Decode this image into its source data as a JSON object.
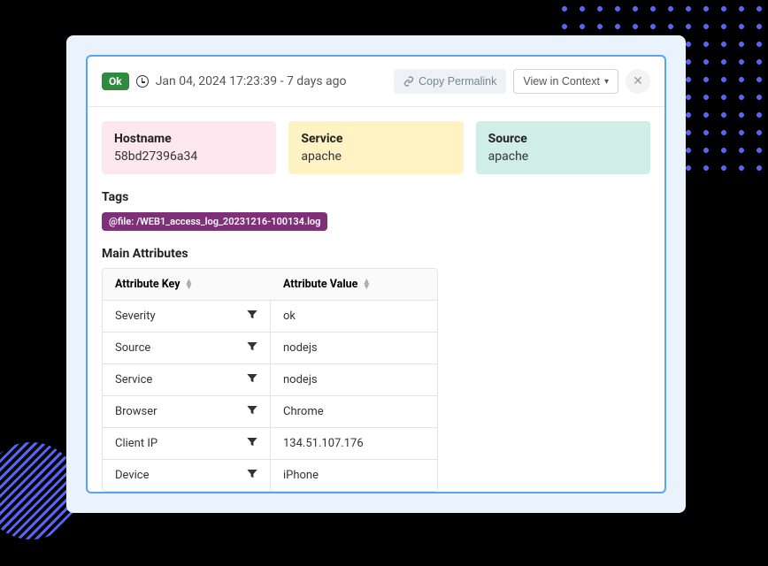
{
  "header": {
    "status": "Ok",
    "timestamp": "Jan 04, 2024 17:23:39 - 7 days ago",
    "copy_label": "Copy Permalink",
    "view_label": "View in Context"
  },
  "info": {
    "hostname_label": "Hostname",
    "hostname_value": "58bd27396a34",
    "service_label": "Service",
    "service_value": "apache",
    "source_label": "Source",
    "source_value": "apache"
  },
  "tags": {
    "title": "Tags",
    "items": [
      "@file: /WEB1_access_log_20231216-100134.log"
    ]
  },
  "attributes": {
    "title": "Main Attributes",
    "key_header": "Attribute Key",
    "value_header": "Attribute Value",
    "rows": [
      {
        "key": "Severity",
        "value": "ok"
      },
      {
        "key": "Source",
        "value": "nodejs"
      },
      {
        "key": "Service",
        "value": "nodejs"
      },
      {
        "key": "Browser",
        "value": "Chrome"
      },
      {
        "key": "Client IP",
        "value": "134.51.107.176"
      },
      {
        "key": "Device",
        "value": "iPhone"
      }
    ]
  }
}
